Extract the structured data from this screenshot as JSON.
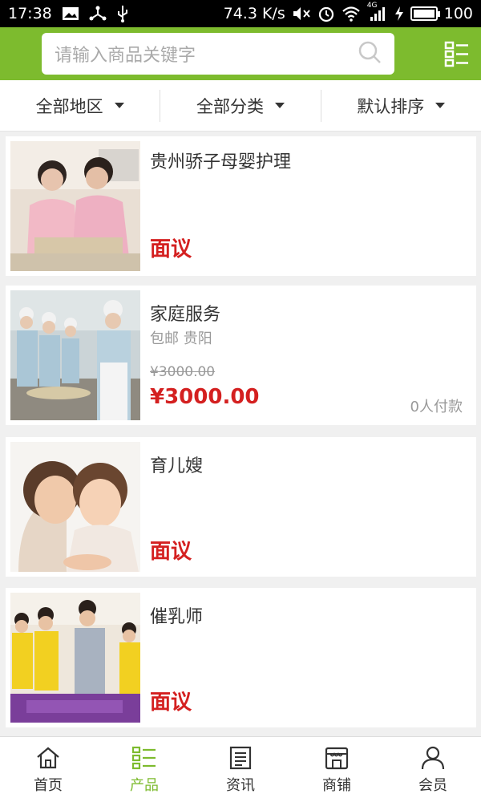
{
  "status_bar": {
    "time": "17:38",
    "speed": "74.3 K/s",
    "network": "4G",
    "battery": "100"
  },
  "header": {
    "search_placeholder": "请输入商品关键字"
  },
  "filters": [
    {
      "label": "全部地区"
    },
    {
      "label": "全部分类"
    },
    {
      "label": "默认排序"
    }
  ],
  "products": [
    {
      "title": "贵州骄子母婴护理",
      "price": "面议"
    },
    {
      "title": "家庭服务",
      "tags": "包邮 贵阳",
      "old_price": "¥3000.00",
      "price": "¥3000.00",
      "paid": "0人付款"
    },
    {
      "title": "育儿嫂",
      "price": "面议"
    },
    {
      "title": "催乳师",
      "price": "面议"
    }
  ],
  "tabs": [
    {
      "label": "首页",
      "icon": "home-icon"
    },
    {
      "label": "产品",
      "icon": "product-list-icon"
    },
    {
      "label": "资讯",
      "icon": "news-icon"
    },
    {
      "label": "商铺",
      "icon": "shop-icon"
    },
    {
      "label": "会员",
      "icon": "user-icon"
    }
  ],
  "colors": {
    "brand": "#7dbb2e",
    "price": "#d42020"
  }
}
